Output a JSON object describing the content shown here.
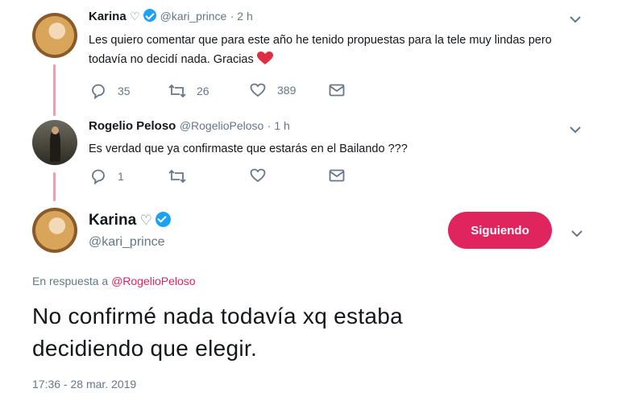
{
  "tweet1": {
    "name": "Karina",
    "heart_symbol": "♡",
    "handle": "@kari_prince",
    "time": "· 2 h",
    "text": "Les quiero comentar que para este año he tenido propuestas para la tele muy lindas pero todavía no decidí nada. Gracias",
    "replies": "35",
    "retweets": "26",
    "likes": "389"
  },
  "tweet2": {
    "name": "Rogelio Peloso",
    "handle": "@RogelioPeloso",
    "time": "· 1 h",
    "text": "Es verdad que ya confirmaste que estarás en el Bailando ???",
    "replies": "1"
  },
  "main_tweet": {
    "name": "Karina",
    "heart_symbol": "♡",
    "handle": "@kari_prince",
    "follow_label": "Siguiendo",
    "reply_prefix": "En respuesta a",
    "reply_to": "@RogelioPeloso",
    "text_line1": "No confirmé nada todavía xq estaba",
    "text_line2": "decidiendo que elegir.",
    "timestamp": "17:36 - 28 mar. 2019"
  },
  "colors": {
    "accent": "#e0245e",
    "verified": "#1da1f2",
    "thread_line": "#e6a0b2",
    "muted": "#657786"
  },
  "icons": [
    "reply-icon",
    "retweet-icon",
    "like-icon",
    "message-icon",
    "chevron-down-icon",
    "verified-icon",
    "heart-emoji-icon"
  ]
}
